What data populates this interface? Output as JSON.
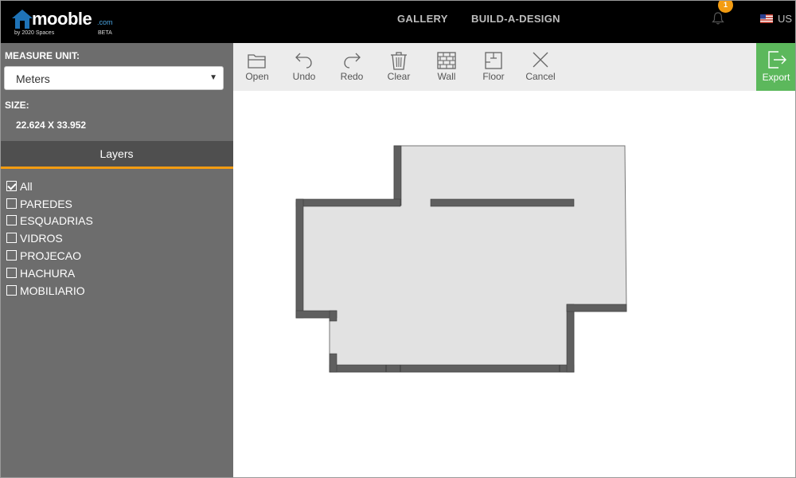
{
  "brand": {
    "name": "mooble",
    "domain": ".com",
    "tagline": "by 2020 Spaces",
    "stage": "BETA",
    "accent_color": "#1f73b7"
  },
  "header": {
    "nav": [
      "GALLERY",
      "BUILD-A-DESIGN"
    ],
    "notification_count": "1",
    "locale": "US",
    "badge_color": "#f39c12"
  },
  "sidebar": {
    "measure_label": "MEASURE UNIT:",
    "measure_value": "Meters",
    "size_label": "SIZE:",
    "size_value": "22.624 X 33.952",
    "layers_title": "Layers",
    "layers": [
      {
        "label": "All",
        "checked": true
      },
      {
        "label": "PAREDES",
        "checked": false
      },
      {
        "label": "ESQUADRIAS",
        "checked": false
      },
      {
        "label": "VIDROS",
        "checked": false
      },
      {
        "label": "PROJECAO",
        "checked": false
      },
      {
        "label": "HACHURA",
        "checked": false
      },
      {
        "label": "MOBILIARIO",
        "checked": false
      }
    ]
  },
  "toolbar": {
    "open": "Open",
    "undo": "Undo",
    "redo": "Redo",
    "clear": "Clear",
    "wall": "Wall",
    "floor": "Floor",
    "cancel": "Cancel",
    "export": "Export",
    "export_color": "#5cb85c"
  },
  "canvas": {
    "floor_color": "#e2e2e2",
    "wall_color": "#5f5f5f"
  }
}
